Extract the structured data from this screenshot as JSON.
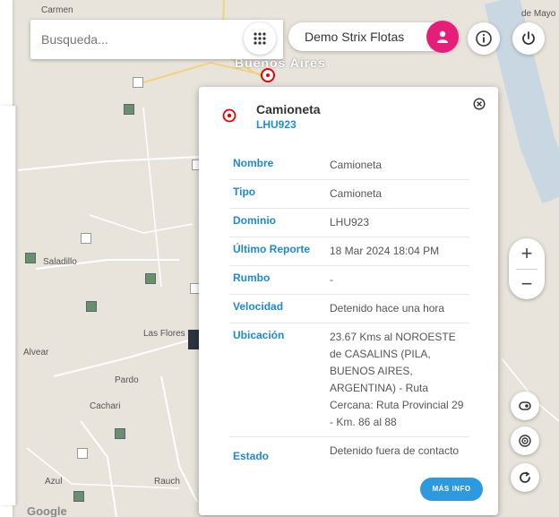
{
  "map": {
    "places": [
      {
        "name": "Carmen",
        "key": "carmen"
      },
      {
        "name": "Buenos Aires",
        "key": "ba"
      },
      {
        "name": "Saladillo",
        "key": "saladillo"
      },
      {
        "name": "Las Flores",
        "key": "lasflores"
      },
      {
        "name": "Alvear",
        "key": "alvear"
      },
      {
        "name": "Pardo",
        "key": "pardo"
      },
      {
        "name": "Cachari",
        "key": "cachari"
      },
      {
        "name": "Rauch",
        "key": "rauch"
      },
      {
        "name": "Azul",
        "key": "azul"
      },
      {
        "name": "de Mayo",
        "key": "demayo"
      }
    ],
    "google_logo": "Google"
  },
  "search": {
    "placeholder": "Busqueda..."
  },
  "user": {
    "name": "Demo Strix Flotas"
  },
  "zoom": {
    "in": "+",
    "out": "−"
  },
  "popup": {
    "title": "Camioneta",
    "plate": "LHU923",
    "rows": [
      {
        "label": "Nombre",
        "value": "Camioneta"
      },
      {
        "label": "Tipo",
        "value": "Camioneta"
      },
      {
        "label": "Dominio",
        "value": "LHU923"
      },
      {
        "label": "Último Reporte",
        "value": "18 Mar 2024 18:04 PM"
      },
      {
        "label": "Rumbo",
        "value": "-"
      },
      {
        "label": "Velocidad",
        "value": "Detenido hace una hora"
      },
      {
        "label": "Ubicación",
        "value": "23.67 Kms al NOROESTE de CASALINS (PILA, BUENOS AIRES, ARGENTINA) - Ruta Cercana: Ruta Provincial 29 - Km. 86 al 88"
      },
      {
        "label": "Estado",
        "value": "Detenido fuera de contacto"
      }
    ],
    "more_button": "MÁS INFO"
  },
  "colors": {
    "accent": "#1e88d0",
    "avatar": "#e51e7a",
    "marker": "#e00000"
  }
}
